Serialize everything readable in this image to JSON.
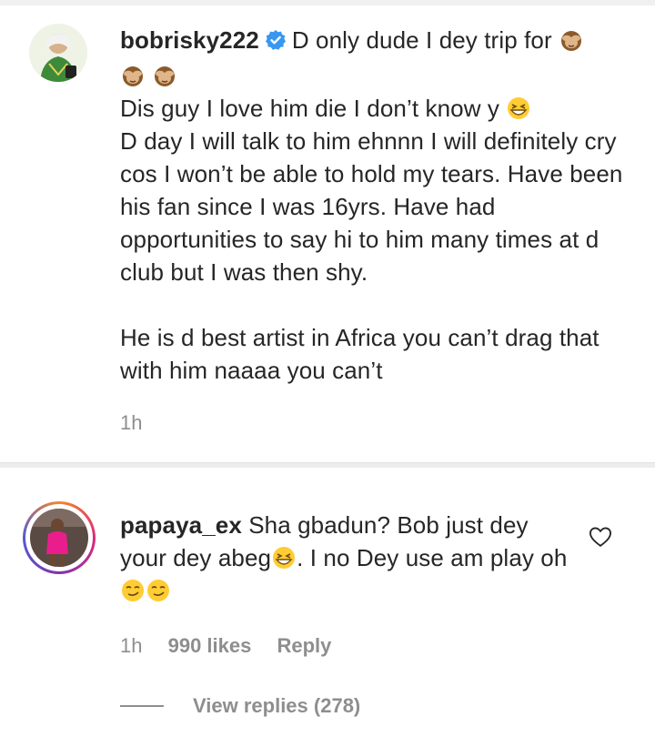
{
  "comment1": {
    "username": "bobrisky222",
    "first_line": "D only dude I dey trip for",
    "line2_text": "Dis guy I love him die I don’t know y",
    "body_rest": "D day I will talk to him ehnnn I will definitely cry cos I won’t be able to hold my tears. Have been his fan since I was 16yrs. Have had opportunities to say hi to him many times at d club but I was then shy.",
    "paragraph2": "He is d best artist in Africa you can’t drag that with him naaaa you can’t",
    "time": "1h"
  },
  "comment2": {
    "username": "papaya_ex",
    "text_part1": "Sha gbadun? Bob just dey your dey abeg",
    "text_part2": ". I no Dey use am play oh",
    "time": "1h",
    "likes": "990 likes",
    "reply": "Reply",
    "view_replies": "View replies (278)"
  },
  "icons": {
    "verified": "verified-badge-icon",
    "monkey": "see-no-evil-monkey-emoji",
    "grin": "grinning-squinting-face-emoji",
    "smirk": "smirking-face-emoji",
    "heart": "heart-outline-icon"
  },
  "colors": {
    "verified_blue": "#3897f0",
    "meta_gray": "#8e8e8e",
    "text": "#262626"
  }
}
